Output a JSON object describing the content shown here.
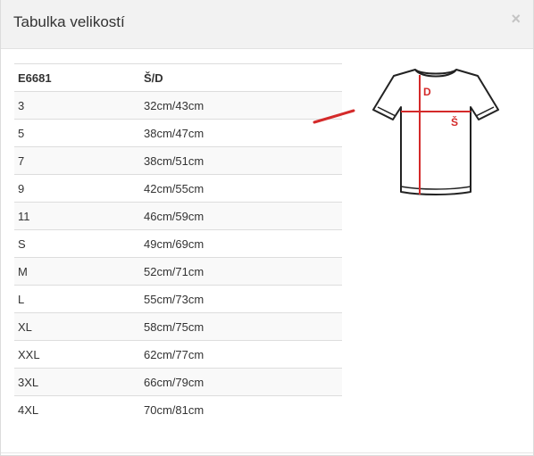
{
  "modal": {
    "title": "Tabulka velikostí",
    "close_label": "×"
  },
  "table": {
    "headers": [
      "E6681",
      "Š/D"
    ],
    "rows": [
      [
        "3",
        "32cm/43cm"
      ],
      [
        "5",
        "38cm/47cm"
      ],
      [
        "7",
        "38cm/51cm"
      ],
      [
        "9",
        "42cm/55cm"
      ],
      [
        "11",
        "46cm/59cm"
      ],
      [
        "S",
        "49cm/69cm"
      ],
      [
        "M",
        "52cm/71cm"
      ],
      [
        "L",
        "55cm/73cm"
      ],
      [
        "XL",
        "58cm/75cm"
      ],
      [
        "XXL",
        "62cm/77cm"
      ],
      [
        "3XL",
        "66cm/79cm"
      ],
      [
        "4XL",
        "70cm/81cm"
      ]
    ]
  },
  "diagram": {
    "length_label": "D",
    "width_label": "Š",
    "accent_color": "#d42a2a"
  }
}
